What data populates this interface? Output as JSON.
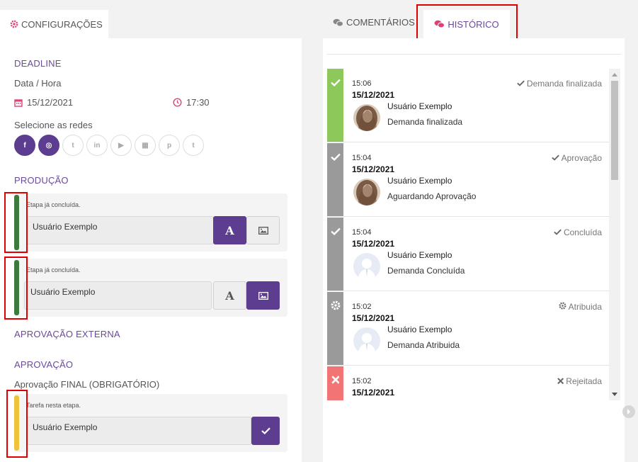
{
  "left": {
    "tab_label": "CONFIGURAÇÕES",
    "deadline_title": "DEADLINE",
    "datetime_label": "Data / Hora",
    "date_value": "15/12/2021",
    "time_value": "17:30",
    "networks_label": "Selecione as redes",
    "networks": [
      {
        "icon": "facebook-icon",
        "glyph": "f",
        "active": true
      },
      {
        "icon": "instagram-icon",
        "glyph": "◎",
        "active": true
      },
      {
        "icon": "twitter-icon",
        "glyph": "t",
        "active": false
      },
      {
        "icon": "linkedin-icon",
        "glyph": "in",
        "active": false
      },
      {
        "icon": "youtube-icon",
        "glyph": "▶",
        "active": false
      },
      {
        "icon": "store-icon",
        "glyph": "▦",
        "active": false
      },
      {
        "icon": "pinterest-icon",
        "glyph": "p",
        "active": false
      },
      {
        "icon": "tumblr-icon",
        "glyph": "t",
        "active": false
      }
    ],
    "production_title": "PRODUÇÃO",
    "stages": [
      {
        "note": "Etapa já concluída.",
        "user": "Usuário Exemplo",
        "bar_color": "#3d7a3d"
      },
      {
        "note": "Etapa já concluída.",
        "user": "Usuário Exemplo",
        "bar_color": "#3d7a3d"
      }
    ],
    "external_approval_title": "APROVAÇÃO EXTERNA",
    "approval_title": "APROVAÇÃO",
    "final_approval_label": "Aprovação FINAL (OBRIGATÓRIO)",
    "approval_stage": {
      "note": "Tarefa nesta etapa.",
      "user": "Usuário Exemplo",
      "bar_color": "#f0c23c"
    },
    "text_button_glyph": "A"
  },
  "right": {
    "tab_comments": "COMENTÁRIOS",
    "tab_history": "HISTÓRICO",
    "entries": [
      {
        "time": "15:06",
        "date": "15/12/2021",
        "status": "Demanda finalizada",
        "status_icon": "check-icon",
        "side_icon": "check-icon",
        "side_color": "#8cc85a",
        "user": "Usuário Exemplo",
        "action": "Demanda finalizada",
        "avatar": "photo"
      },
      {
        "time": "15:04",
        "date": "15/12/2021",
        "status": "Aprovação",
        "status_icon": "check-icon",
        "side_icon": "check-icon",
        "side_color": "#9a9a9a",
        "user": "Usuário Exemplo",
        "action": "Aguardando Aprovação",
        "avatar": "photo"
      },
      {
        "time": "15:04",
        "date": "15/12/2021",
        "status": "Concluída",
        "status_icon": "check-icon",
        "side_icon": "check-icon",
        "side_color": "#9a9a9a",
        "user": "Usuário Exemplo",
        "action": "Demanda Concluída",
        "avatar": "placeholder"
      },
      {
        "time": "15:02",
        "date": "15/12/2021",
        "status": "Atribuida",
        "status_icon": "gear-icon",
        "side_icon": "gear-icon",
        "side_color": "#9a9a9a",
        "user": "Usuário Exemplo",
        "action": "Demanda Atribuida",
        "avatar": "placeholder"
      },
      {
        "time": "15:02",
        "date": "15/12/2021",
        "status": "Rejeitada",
        "status_icon": "x-icon",
        "side_icon": "x-icon",
        "side_color": "#f27474",
        "user": "",
        "action": "",
        "avatar": "none"
      }
    ]
  },
  "colors": {
    "accent": "#5c3d8f",
    "accent_text": "#6a4a9c",
    "highlight": "#e00000"
  }
}
